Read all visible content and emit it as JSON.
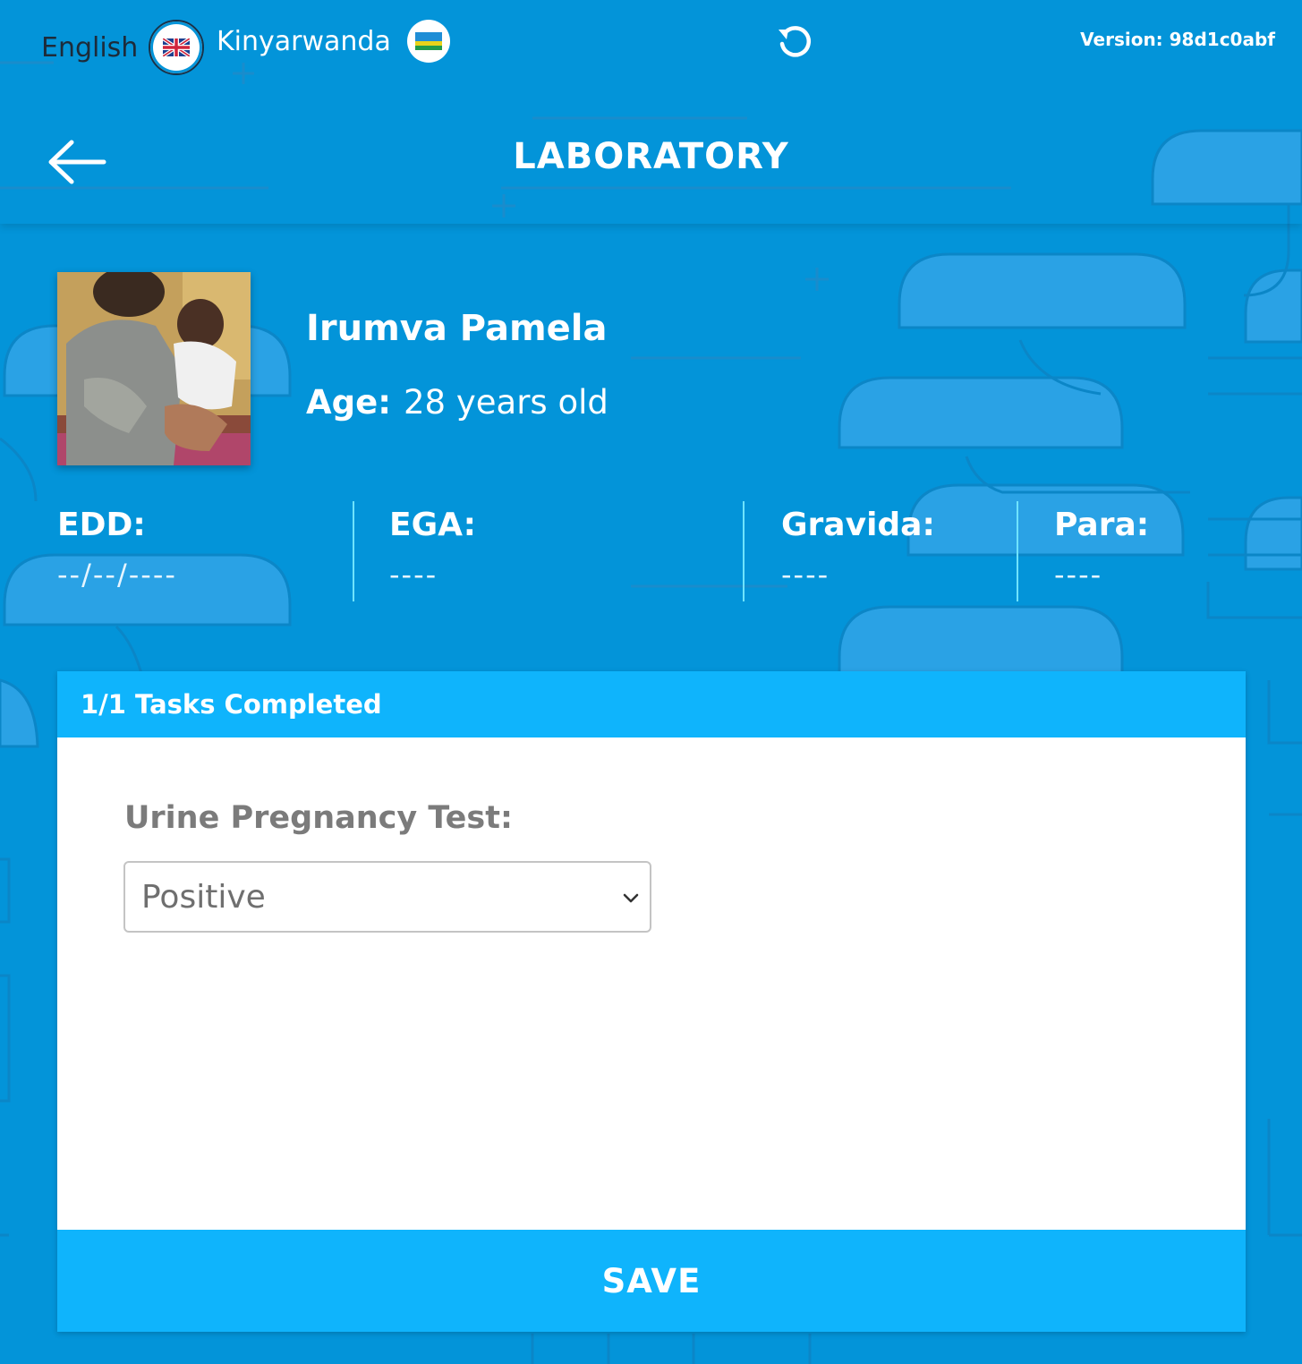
{
  "header": {
    "language_english": "English",
    "language_kinyarwanda": "Kinyarwanda",
    "version": "Version: 98d1c0abf",
    "title": "LABORATORY"
  },
  "patient": {
    "name": "Irumva Pamela",
    "age_label": "Age:",
    "age_value": "28 years old"
  },
  "stats": [
    {
      "label": "EDD:",
      "value": "--/--/----"
    },
    {
      "label": "EGA:",
      "value": "----"
    },
    {
      "label": "Gravida:",
      "value": "----"
    },
    {
      "label": "Para:",
      "value": "----"
    }
  ],
  "tasks": {
    "header": "1/1 Tasks Completed",
    "field_label": "Urine Pregnancy Test:",
    "selected_value": "Positive",
    "save_label": "SAVE"
  },
  "colors": {
    "background": "#0394d9",
    "accent": "#0fb4fc",
    "divider": "#6fe3ff"
  },
  "icons": [
    "uk-flag-icon",
    "rwanda-flag-icon",
    "refresh-icon",
    "back-arrow-icon",
    "chevron-down-icon"
  ]
}
